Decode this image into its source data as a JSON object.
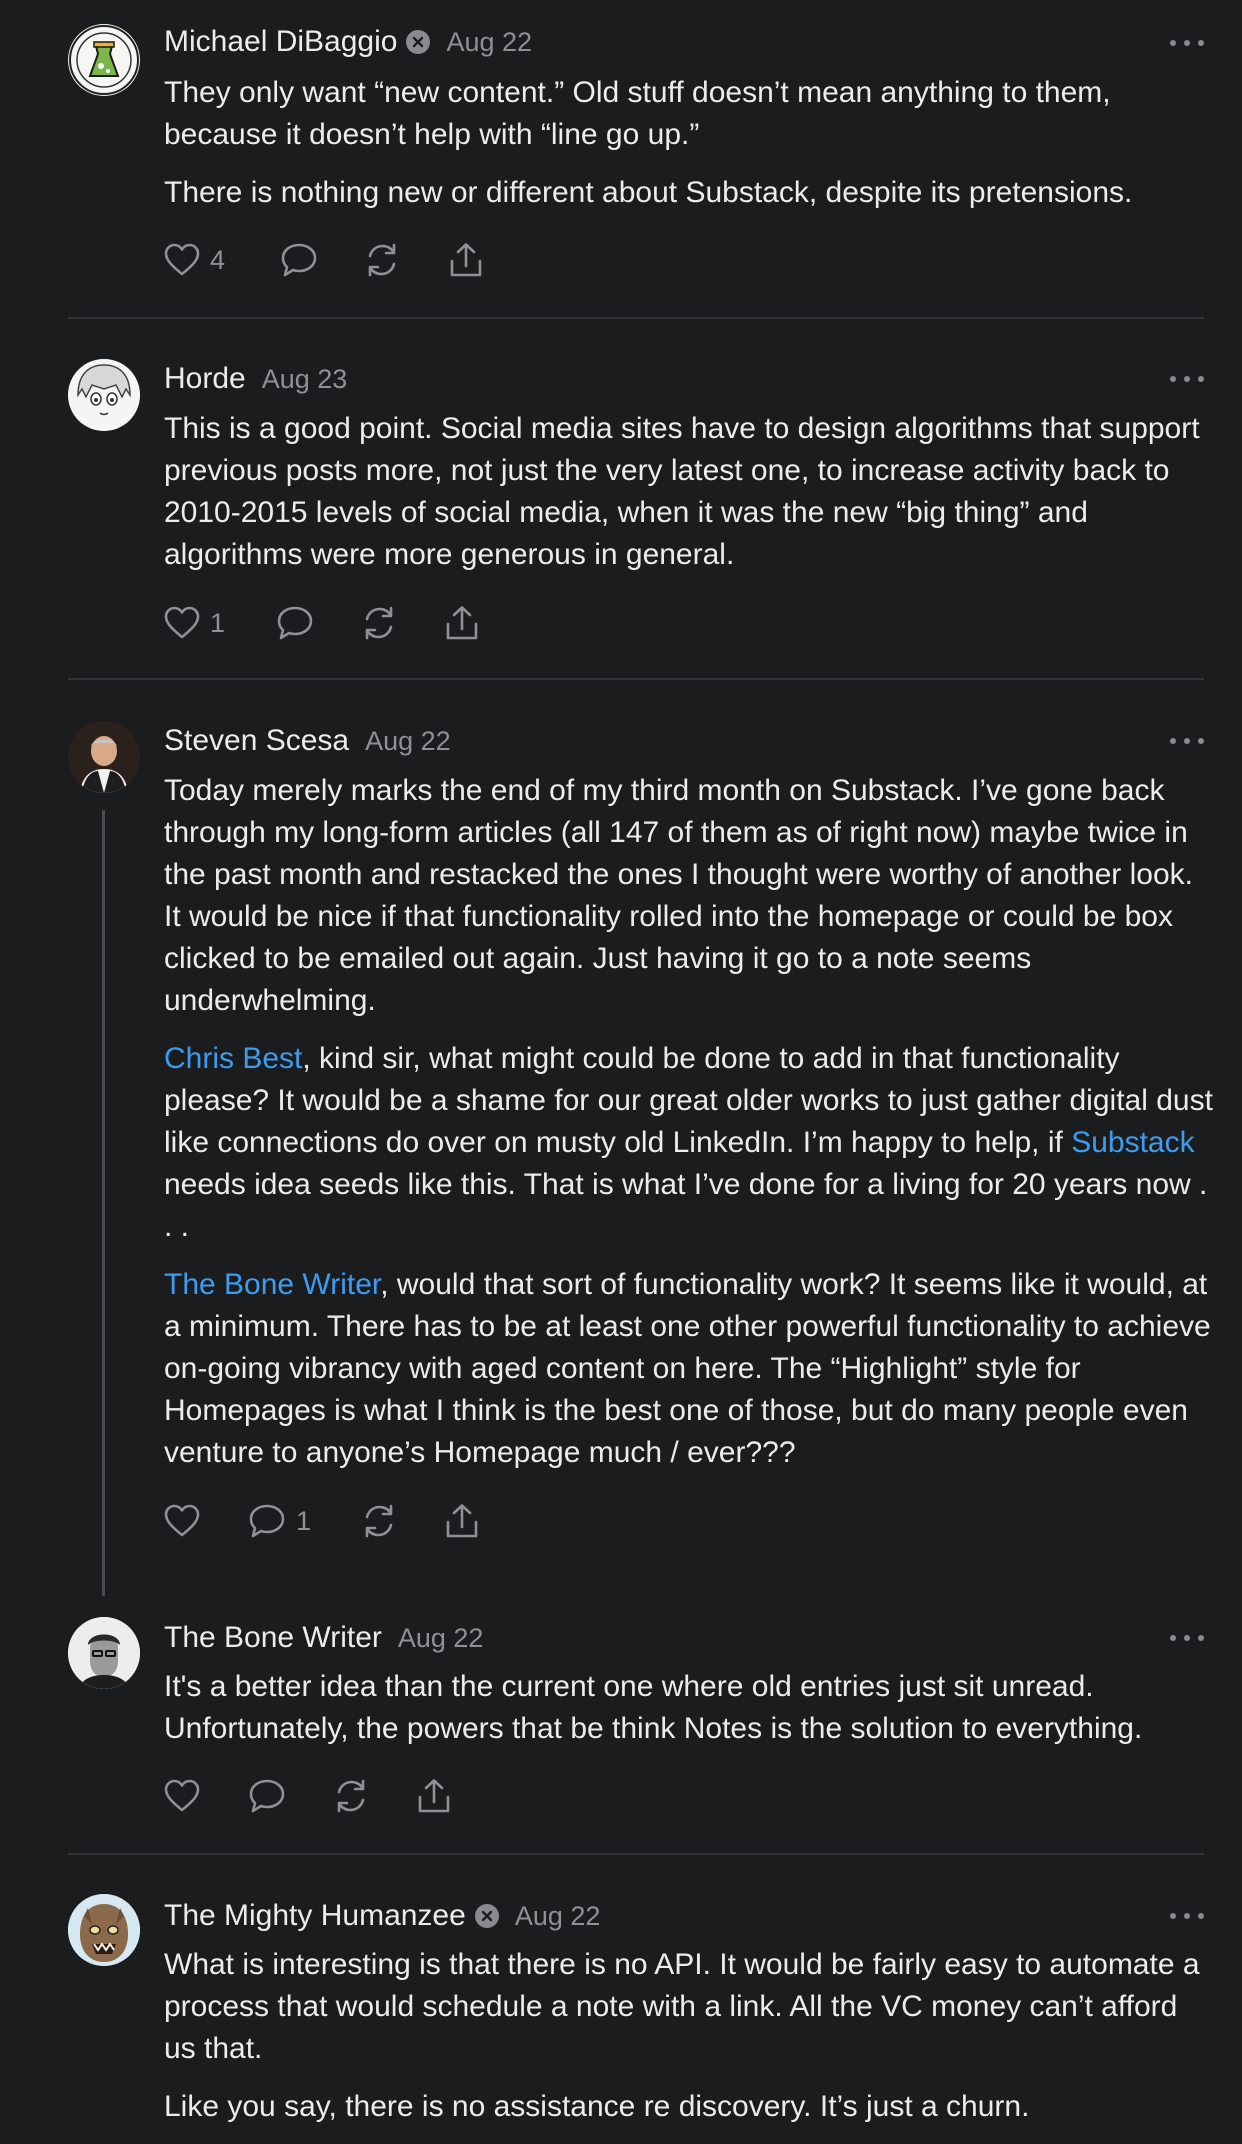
{
  "comments": [
    {
      "author": "Michael DiBaggio",
      "date": "Aug 22",
      "paragraphs": [
        "They only want “new content.” Old stuff doesn’t mean anything to them, because it doesn’t help with “line go up.”",
        "There is nothing new or different about Substack, despite its pretensions."
      ],
      "like_count": "4",
      "reply_count": ""
    },
    {
      "author": "Horde",
      "date": "Aug 23",
      "paragraphs": [
        "This is a good point. Social media sites have to design algorithms that support previous posts more, not just the very latest one, to increase activity back to 2010-2015 levels of social media, when it was the new “big thing” and algorithms were more generous in general."
      ],
      "like_count": "1",
      "reply_count": ""
    },
    {
      "author": "Steven Scesa",
      "date": "Aug 22",
      "paragraphs": [
        "Today merely marks the end of my third month on Substack. I’ve gone back through my long-form articles (all 147 of them as of right now) maybe twice in the past month and restacked the ones I thought were worthy of another look. It would be nice if that functionality rolled into the homepage or could be box clicked to be emailed out again. Just having it go to a note seems underwhelming."
      ],
      "p2": {
        "mention1": "Chris Best",
        "text1": ", kind sir, what might could be done to add in that functionality please? It would be a shame for our great older works to just gather digital dust like connections do over on musty old LinkedIn. I’m happy to help, if ",
        "mention2": "Substack",
        "text2": " needs idea seeds like this. That is what I’ve done for a living for 20 years now . . ."
      },
      "p3": {
        "mention": "The Bone Writer",
        "text": ", would that sort of functionality work? It seems like it would, at a minimum. There has to be at least one other powerful functionality to achieve on-going vibrancy with aged content on here. The “Highlight” style for Homepages is what I think is the best one of those, but do many people even venture to anyone’s Homepage much / ever???"
      },
      "like_count": "",
      "reply_count": "1"
    },
    {
      "author": "The Bone Writer",
      "date": "Aug 22",
      "paragraphs": [
        "It's a better idea than the current one where old entries just sit unread. Unfortunately, the powers that be think Notes is the solution to everything."
      ],
      "like_count": "",
      "reply_count": ""
    },
    {
      "author": "The Mighty Humanzee",
      "date": "Aug 22",
      "paragraphs": [
        "What is interesting is that there is no API. It would be fairly easy to automate a process that would schedule a note with a link. All the VC money can’t afford us that.",
        "Like you say, there is no assistance re discovery. It’s just a churn."
      ],
      "like_count": "",
      "reply_count": ""
    }
  ],
  "colors": {
    "background": "#1b1c1e",
    "text": "#ececed",
    "muted": "#8f9094",
    "link": "#3d9cf0",
    "divider": "#333437"
  },
  "icons": [
    "heart-icon",
    "comment-icon",
    "restack-icon",
    "share-icon",
    "more-icon",
    "verified-badge-icon"
  ]
}
